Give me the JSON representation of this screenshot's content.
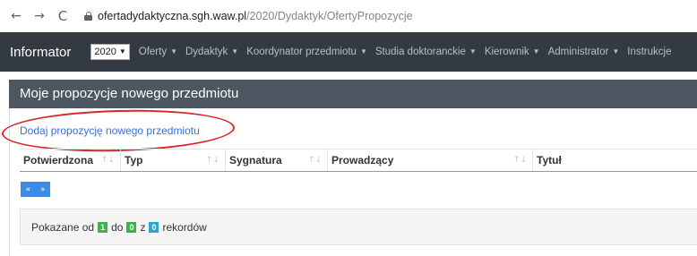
{
  "browser": {
    "back_icon": "←",
    "forward_icon": "→",
    "reload_icon": "C",
    "url_host": "ofertadydaktyczna.sgh.waw.pl",
    "url_path": "/2020/Dydaktyk/OfertyPropozycje"
  },
  "navbar": {
    "brand": "Informator",
    "year_select": "2020",
    "menu": [
      {
        "label": "Oferty"
      },
      {
        "label": "Dydaktyk"
      },
      {
        "label": "Koordynator przedmiotu"
      },
      {
        "label": "Studia doktoranckie"
      },
      {
        "label": "Kierownik"
      },
      {
        "label": "Administrator"
      },
      {
        "label": "Instrukcje"
      }
    ]
  },
  "panel": {
    "title": "Moje propozycje nowego przedmiotu",
    "add_link": "Dodaj propozycję nowego przedmiotu"
  },
  "table": {
    "columns": [
      "Potwierdzona",
      "Typ",
      "Sygnatura",
      "Prowadzący",
      "Tytuł"
    ]
  },
  "pager": {
    "prev": "«",
    "next": "»"
  },
  "info": {
    "prefix": "Pokazane od",
    "from": "1",
    "to_label": "do",
    "to": "0",
    "of_label": "z",
    "total": "0",
    "suffix": "rekordów"
  },
  "colors": {
    "navbar_bg": "#333a41",
    "panel_header_bg": "#4d5761",
    "link": "#3a6fd8",
    "highlight": "#d9262b",
    "pager_bg": "#3a8bf0",
    "badge_green": "#3cb44b",
    "badge_blue": "#2aa7c9"
  }
}
